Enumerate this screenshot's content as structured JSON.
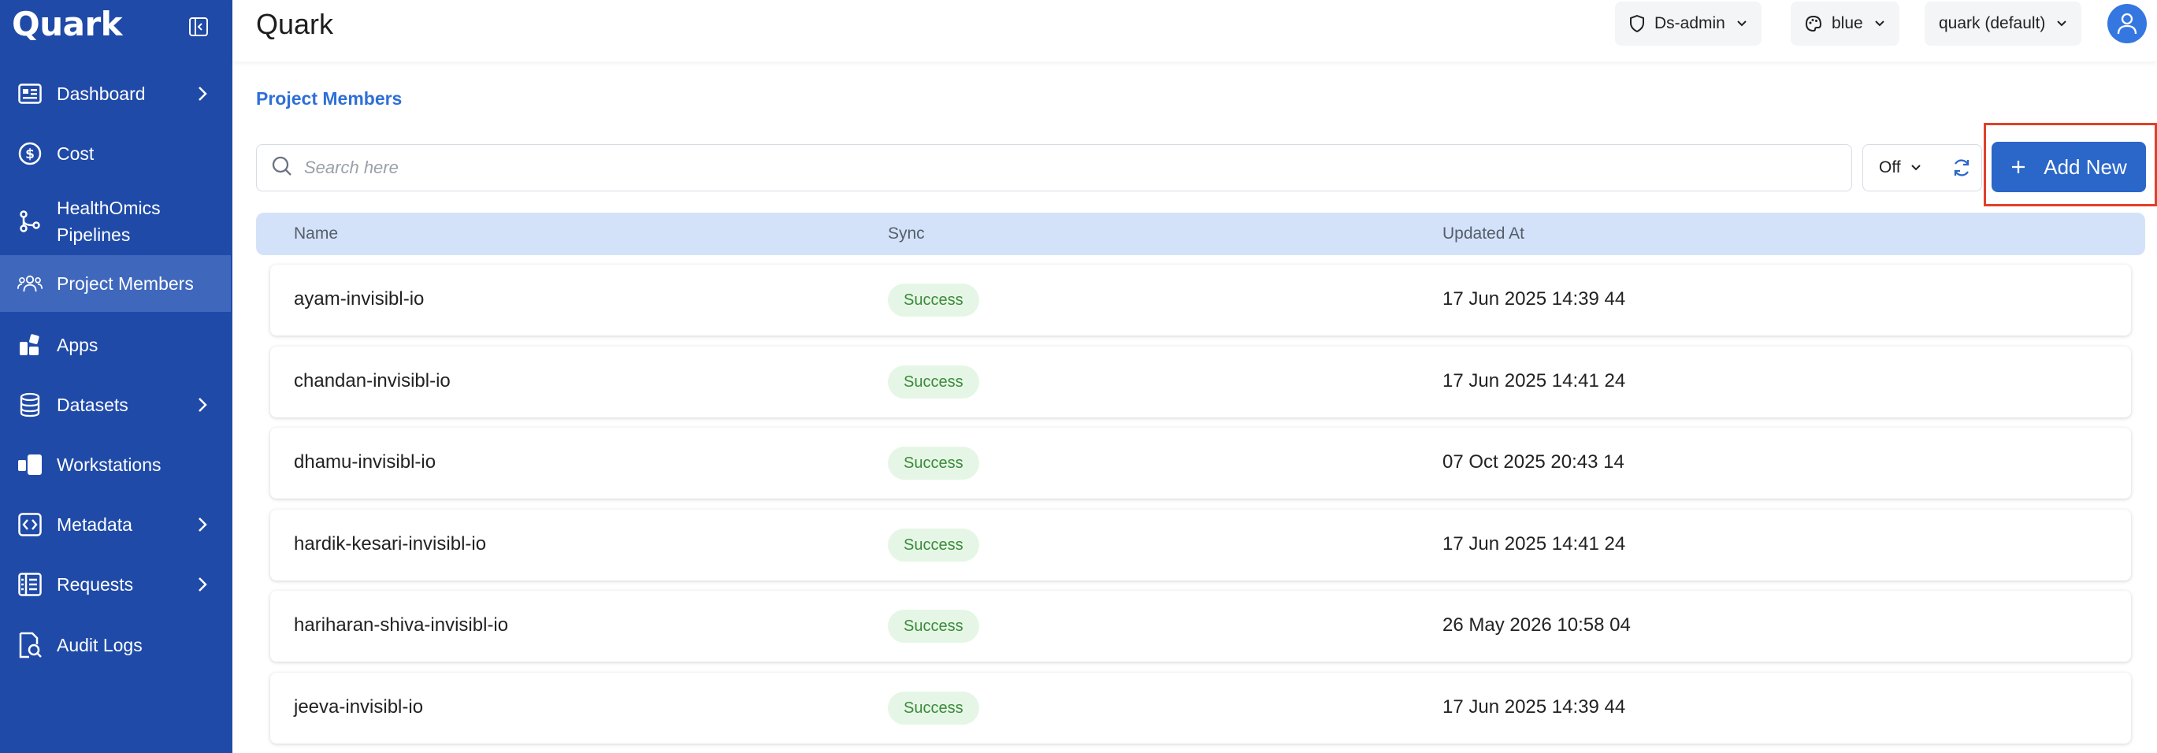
{
  "app": {
    "brand": "Quark",
    "title": "Quark"
  },
  "sidebar": {
    "items": [
      {
        "label": "Dashboard",
        "icon": "dashboard-icon",
        "chevron": true
      },
      {
        "label": "Cost",
        "icon": "dollar-icon",
        "chevron": false
      },
      {
        "label": "HealthOmics Pipelines",
        "icon": "pipeline-icon",
        "chevron": false
      },
      {
        "label": "Project Members",
        "icon": "members-icon",
        "chevron": false,
        "active": true
      },
      {
        "label": "Apps",
        "icon": "apps-icon",
        "chevron": false
      },
      {
        "label": "Datasets",
        "icon": "database-icon",
        "chevron": true
      },
      {
        "label": "Workstations",
        "icon": "workstation-icon",
        "chevron": false
      },
      {
        "label": "Metadata",
        "icon": "code-icon",
        "chevron": true
      },
      {
        "label": "Requests",
        "icon": "requests-icon",
        "chevron": true
      },
      {
        "label": "Audit Logs",
        "icon": "audit-icon",
        "chevron": false
      }
    ]
  },
  "topbar": {
    "role": "Ds-admin",
    "theme": "blue",
    "project": "quark (default)"
  },
  "page": {
    "breadcrumb": "Project Members"
  },
  "toolbar": {
    "search_placeholder": "Search here",
    "auto_refresh": "Off",
    "add_label": "Add New"
  },
  "table": {
    "columns": [
      "Name",
      "Sync",
      "Updated At"
    ],
    "rows": [
      {
        "name": "ayam-invisibl-io",
        "sync": "Success",
        "updated": "17 Jun 2025 14:39 44"
      },
      {
        "name": "chandan-invisibl-io",
        "sync": "Success",
        "updated": "17 Jun 2025 14:41 24"
      },
      {
        "name": "dhamu-invisibl-io",
        "sync": "Success",
        "updated": "07 Oct 2025 20:43 14"
      },
      {
        "name": "hardik-kesari-invisibl-io",
        "sync": "Success",
        "updated": "17 Jun 2025 14:41 24"
      },
      {
        "name": "hariharan-shiva-invisibl-io",
        "sync": "Success",
        "updated": "26 May 2026 10:58 04"
      },
      {
        "name": "jeeva-invisibl-io",
        "sync": "Success",
        "updated": "17 Jun 2025 14:39 44"
      }
    ]
  },
  "colors": {
    "sidebar": "#1f4aa8",
    "accent": "#2b66c9",
    "success_bg": "#e6f6e6",
    "success_text": "#3a8a3a",
    "highlight": "#e0402a"
  }
}
